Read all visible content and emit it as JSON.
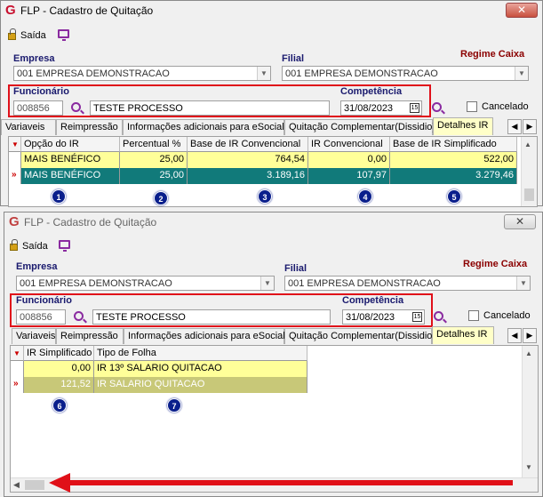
{
  "window1": {
    "title": "FLP - Cadastro de Quitação",
    "close_label": "✕",
    "toolbar": {
      "exit_label": "Saída"
    },
    "empresa_label": "Empresa",
    "empresa_value": "001 EMPRESA DEMONSTRACAO",
    "filial_label": "Filial",
    "filial_value": "001 EMPRESA DEMONSTRACAO",
    "regime_label": "Regime Caixa",
    "funcionario_label": "Funcionário",
    "funcionario_code": "008856",
    "funcionario_name": "TESTE PROCESSO",
    "competencia_label": "Competência",
    "competencia_value": "31/08/2023",
    "cancelado_label": "Cancelado",
    "calendar_label": "15",
    "tabs": [
      "Variaveis",
      "Reimpressão",
      "Informações adicionais para eSocial",
      "Quitação Complementar(Dissidio)",
      "Detalhes IR"
    ],
    "grid": {
      "columns": [
        "Opção do IR",
        "Percentual %",
        "Base de IR Convencional",
        "IR Convencional",
        "Base de IR Simplificado"
      ],
      "rows": [
        [
          "MAIS BENÉFICO",
          "25,00",
          "764,54",
          "0,00",
          "522,00"
        ],
        [
          "MAIS BENÉFICO",
          "25,00",
          "3.189,16",
          "107,97",
          "3.279,46"
        ]
      ]
    },
    "badges": [
      "1",
      "2",
      "3",
      "4",
      "5"
    ]
  },
  "window2": {
    "title": "FLP - Cadastro de Quitação",
    "close_label": "✕",
    "toolbar": {
      "exit_label": "Saída"
    },
    "empresa_label": "Empresa",
    "empresa_value": "001 EMPRESA DEMONSTRACAO",
    "filial_label": "Filial",
    "filial_value": "001 EMPRESA DEMONSTRACAO",
    "regime_label": "Regime Caixa",
    "funcionario_label": "Funcionário",
    "funcionario_code": "008856",
    "funcionario_name": "TESTE PROCESSO",
    "competencia_label": "Competência",
    "competencia_value": "31/08/2023",
    "cancelado_label": "Cancelado",
    "calendar_label": "15",
    "tabs": [
      "Variaveis",
      "Reimpressão",
      "Informações adicionais para eSocial",
      "Quitação Complementar(Dissidio)",
      "Detalhes IR"
    ],
    "grid": {
      "columns": [
        "IR Simplificado",
        "Tipo de Folha"
      ],
      "rows": [
        [
          "0,00",
          "IR 13º SALARIO QUITACAO"
        ],
        [
          "121,52",
          "IR SALARIO QUITACAO"
        ]
      ]
    },
    "badges": [
      "6",
      "7"
    ]
  },
  "colors": {
    "highlight_border": "#e0101a",
    "active_tab": "#ffffc8",
    "row_yellow": "#ffff99",
    "row_teal": "#117a7a",
    "badge": "#0a1f8c",
    "arrow": "#e01018"
  }
}
